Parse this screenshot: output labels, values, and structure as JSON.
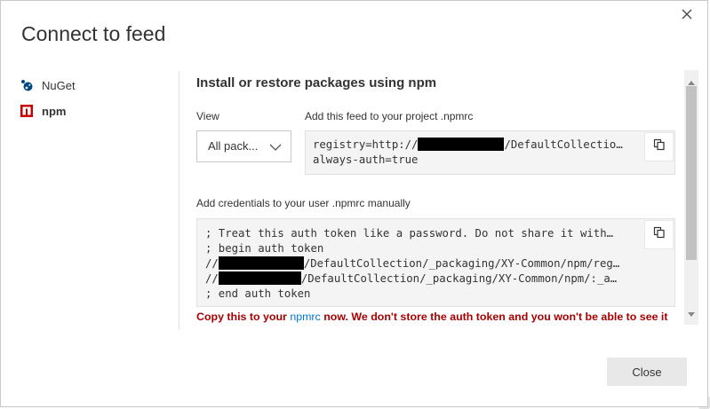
{
  "dialog": {
    "title": "Connect to feed",
    "close_button_label": "Close"
  },
  "nav": {
    "items": [
      {
        "label": "NuGet",
        "icon": "nuget-icon",
        "active": false
      },
      {
        "label": "npm",
        "icon": "npm-icon",
        "active": true
      }
    ]
  },
  "main": {
    "section_title": "Install or restore packages using npm",
    "view_label": "View",
    "view_selected": "All pack...",
    "project_label": "Add this feed to your project .npmrc",
    "project_code": {
      "line1_prefix": "registry=http://",
      "line1_suffix": "/DefaultCollectio…",
      "line2": "always-auth=true"
    },
    "credentials_label": "Add credentials to your user .npmrc manually",
    "credentials_code": {
      "line1": "; Treat this auth token like a password. Do not share it with…",
      "line2": "; begin auth token",
      "line3_prefix": "//",
      "line3_suffix": "/DefaultCollection/_packaging/XY-Common/npm/reg…",
      "line4_prefix": "//",
      "line4_suffix": "/DefaultCollection/_packaging/XY-Common/npm/:_a…",
      "line5": "; end auth token"
    },
    "warning": {
      "before": "Copy this to your ",
      "link": "npmrc",
      "after": " now. We don't store the auth token and you won't be able to see it"
    }
  },
  "colors": {
    "warning": "#a80000",
    "link": "#0078d4",
    "npm_red": "#cb0000",
    "nuget_blue": "#004880"
  }
}
